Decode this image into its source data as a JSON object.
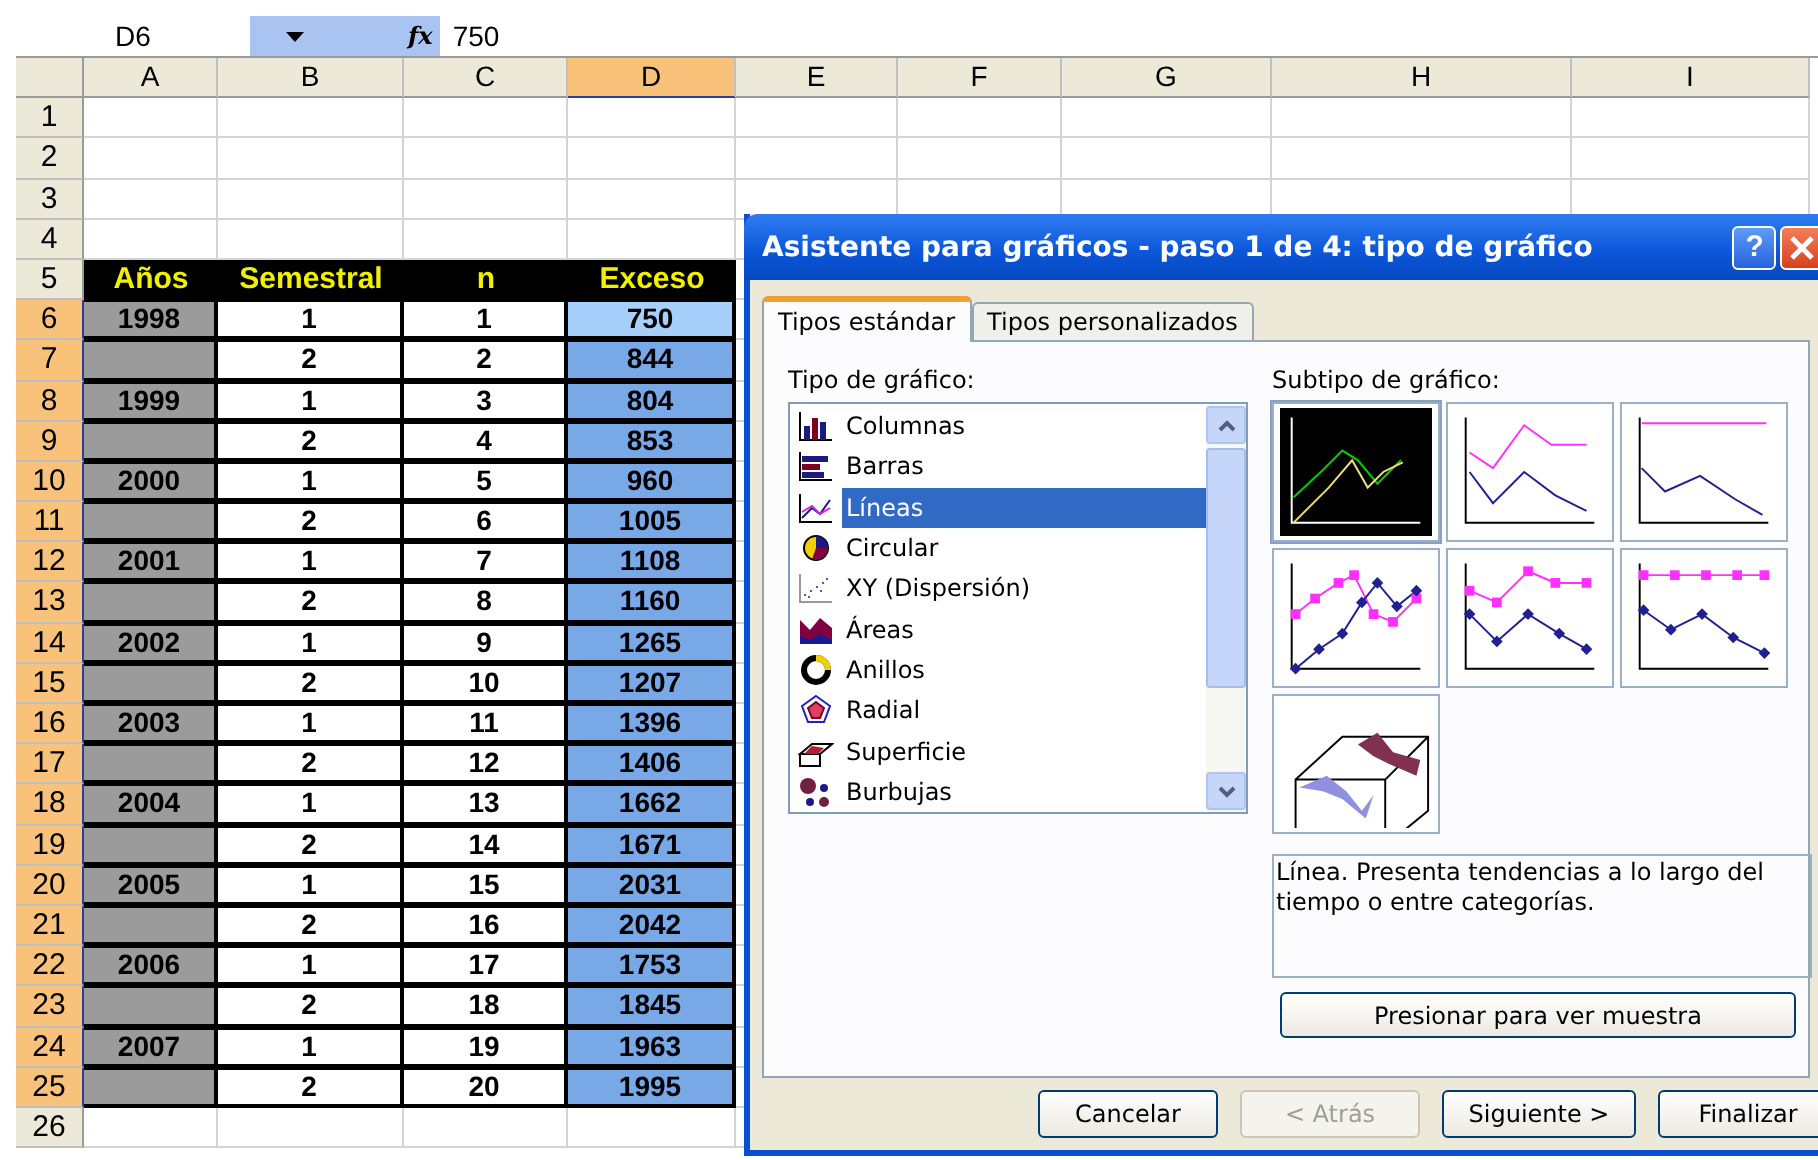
{
  "formula_bar": {
    "name_box": "D6",
    "fx_label": "fx",
    "value": "750"
  },
  "sheet": {
    "columns": [
      {
        "label": "A",
        "selected": false
      },
      {
        "label": "B",
        "selected": false
      },
      {
        "label": "C",
        "selected": false
      },
      {
        "label": "D",
        "selected": true
      },
      {
        "label": "E",
        "selected": false
      },
      {
        "label": "F",
        "selected": false
      },
      {
        "label": "G",
        "selected": false
      },
      {
        "label": "H",
        "selected": false
      },
      {
        "label": "I",
        "selected": false
      }
    ],
    "rows": [
      {
        "number": "1",
        "kind": "empty",
        "selected": false
      },
      {
        "number": "2",
        "kind": "empty",
        "selected": false
      },
      {
        "number": "3",
        "kind": "empty",
        "selected": false
      },
      {
        "number": "4",
        "kind": "empty",
        "selected": false
      },
      {
        "number": "5",
        "kind": "header",
        "selected": false,
        "cells": {
          "year": "Años",
          "semester": "Semestral",
          "n": "n",
          "excess": "Exceso"
        }
      },
      {
        "number": "6",
        "kind": "data",
        "selected": true,
        "active": true,
        "cells": {
          "year": "1998",
          "semester": "1",
          "n": "1",
          "excess": "750"
        }
      },
      {
        "number": "7",
        "kind": "data",
        "selected": true,
        "active": false,
        "cells": {
          "semester": "2",
          "n": "2",
          "excess": "844"
        }
      },
      {
        "number": "8",
        "kind": "data",
        "selected": true,
        "active": false,
        "cells": {
          "year": "1999",
          "semester": "1",
          "n": "3",
          "excess": "804"
        }
      },
      {
        "number": "9",
        "kind": "data",
        "selected": true,
        "active": false,
        "cells": {
          "semester": "2",
          "n": "4",
          "excess": "853"
        }
      },
      {
        "number": "10",
        "kind": "data",
        "selected": true,
        "active": false,
        "cells": {
          "year": "2000",
          "semester": "1",
          "n": "5",
          "excess": "960"
        }
      },
      {
        "number": "11",
        "kind": "data",
        "selected": true,
        "active": false,
        "cells": {
          "semester": "2",
          "n": "6",
          "excess": "1005"
        }
      },
      {
        "number": "12",
        "kind": "data",
        "selected": true,
        "active": false,
        "cells": {
          "year": "2001",
          "semester": "1",
          "n": "7",
          "excess": "1108"
        }
      },
      {
        "number": "13",
        "kind": "data",
        "selected": true,
        "active": false,
        "cells": {
          "semester": "2",
          "n": "8",
          "excess": "1160"
        }
      },
      {
        "number": "14",
        "kind": "data",
        "selected": true,
        "active": false,
        "cells": {
          "year": "2002",
          "semester": "1",
          "n": "9",
          "excess": "1265"
        }
      },
      {
        "number": "15",
        "kind": "data",
        "selected": true,
        "active": false,
        "cells": {
          "semester": "2",
          "n": "10",
          "excess": "1207"
        }
      },
      {
        "number": "16",
        "kind": "data",
        "selected": true,
        "active": false,
        "cells": {
          "year": "2003",
          "semester": "1",
          "n": "11",
          "excess": "1396"
        }
      },
      {
        "number": "17",
        "kind": "data",
        "selected": true,
        "active": false,
        "cells": {
          "semester": "2",
          "n": "12",
          "excess": "1406"
        }
      },
      {
        "number": "18",
        "kind": "data",
        "selected": true,
        "active": false,
        "cells": {
          "year": "2004",
          "semester": "1",
          "n": "13",
          "excess": "1662"
        }
      },
      {
        "number": "19",
        "kind": "data",
        "selected": true,
        "active": false,
        "cells": {
          "semester": "2",
          "n": "14",
          "excess": "1671"
        }
      },
      {
        "number": "20",
        "kind": "data",
        "selected": true,
        "active": false,
        "cells": {
          "year": "2005",
          "semester": "1",
          "n": "15",
          "excess": "2031"
        }
      },
      {
        "number": "21",
        "kind": "data",
        "selected": true,
        "active": false,
        "cells": {
          "semester": "2",
          "n": "16",
          "excess": "2042"
        }
      },
      {
        "number": "22",
        "kind": "data",
        "selected": true,
        "active": false,
        "cells": {
          "year": "2006",
          "semester": "1",
          "n": "17",
          "excess": "1753"
        }
      },
      {
        "number": "23",
        "kind": "data",
        "selected": true,
        "active": false,
        "cells": {
          "semester": "2",
          "n": "18",
          "excess": "1845"
        }
      },
      {
        "number": "24",
        "kind": "data",
        "selected": true,
        "active": false,
        "cells": {
          "year": "2007",
          "semester": "1",
          "n": "19",
          "excess": "1963"
        }
      },
      {
        "number": "25",
        "kind": "data",
        "selected": true,
        "active": false,
        "cells": {
          "semester": "2",
          "n": "20",
          "excess": "1995"
        }
      },
      {
        "number": "26",
        "kind": "empty",
        "selected": false
      }
    ]
  },
  "dialog": {
    "title": "Asistente para gráficos - paso 1 de 4: tipo de gráfico",
    "help_button": "?",
    "tabs": [
      {
        "label": "Tipos estándar",
        "selected": true
      },
      {
        "label": "Tipos personalizados",
        "selected": false
      }
    ],
    "type_label": "Tipo de gráfico:",
    "chart_types": [
      {
        "label": "Columnas",
        "selected": false
      },
      {
        "label": "Barras",
        "selected": false
      },
      {
        "label": "Líneas",
        "selected": true
      },
      {
        "label": "Circular",
        "selected": false
      },
      {
        "label": "XY (Dispersión)",
        "selected": false
      },
      {
        "label": "Áreas",
        "selected": false
      },
      {
        "label": "Anillos",
        "selected": false
      },
      {
        "label": "Radial",
        "selected": false
      },
      {
        "label": "Superficie",
        "selected": false
      },
      {
        "label": "Burbujas",
        "selected": false
      }
    ],
    "subtype_label": "Subtipo de gráfico:",
    "subtypes": [
      {
        "selected": true
      },
      {
        "selected": false
      },
      {
        "selected": false
      },
      {
        "selected": false
      },
      {
        "selected": false
      },
      {
        "selected": false
      },
      {
        "selected": false
      }
    ],
    "description": "Línea. Presenta tendencias a lo largo del tiempo o entre categorías.",
    "preview_button": "Presionar para ver muestra",
    "buttons": [
      {
        "label": "Cancelar",
        "disabled": false
      },
      {
        "label": "< Atrás",
        "disabled": true
      },
      {
        "label": "Siguiente >",
        "disabled": false
      },
      {
        "label": "Finalizar",
        "disabled": false
      }
    ]
  }
}
